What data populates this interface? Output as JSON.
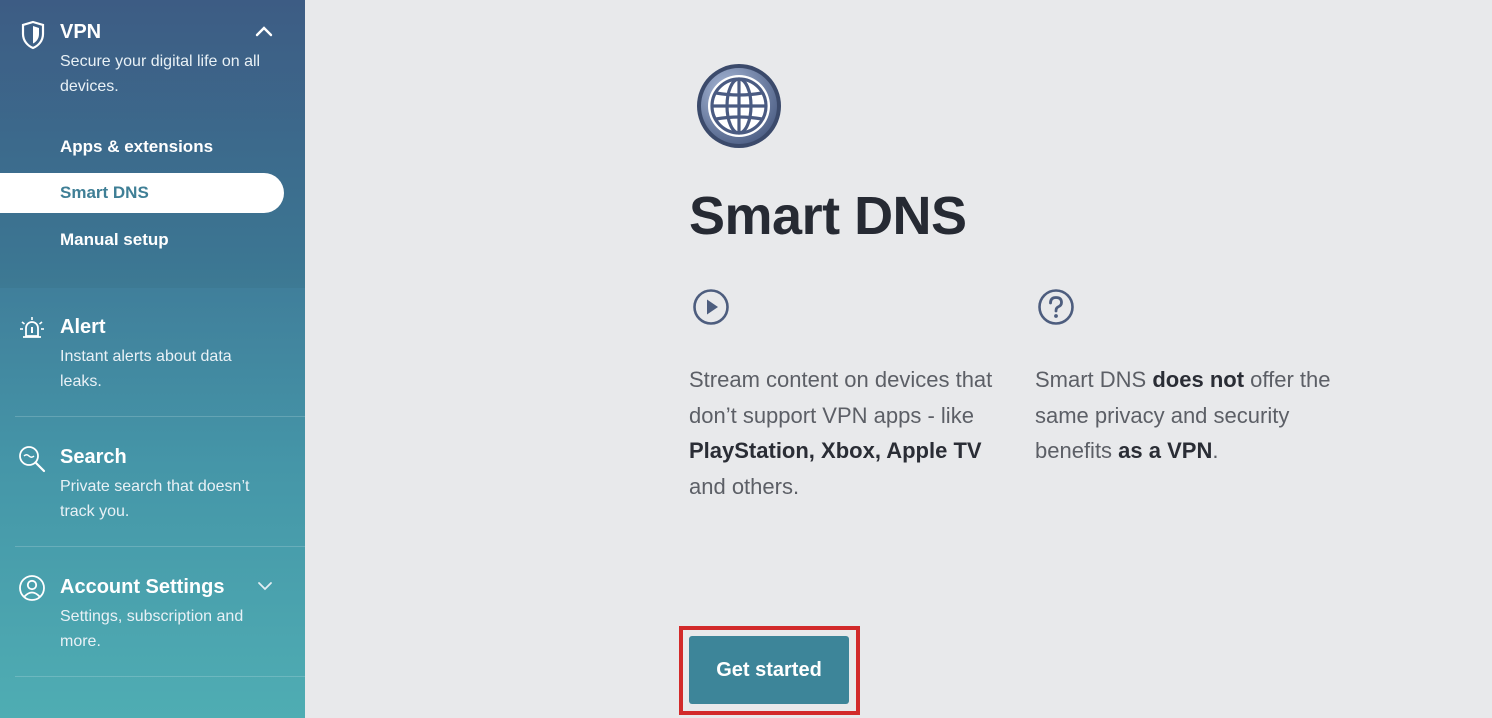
{
  "sidebar": {
    "vpn": {
      "title": "VPN",
      "description": "Secure your digital life on all devices.",
      "items": [
        {
          "label": "Apps & extensions",
          "active": false
        },
        {
          "label": "Smart DNS",
          "active": true
        },
        {
          "label": "Manual setup",
          "active": false
        }
      ]
    },
    "alert": {
      "title": "Alert",
      "description": "Instant alerts about data leaks."
    },
    "search": {
      "title": "Search",
      "description": "Private search that doesn’t track you."
    },
    "account": {
      "title": "Account Settings",
      "description": "Settings, subscription and more."
    }
  },
  "main": {
    "title": "Smart DNS",
    "left_col": {
      "pre": "Stream content on devices that don’t support VPN apps - like ",
      "bold": "PlayStation, Xbox, Apple TV",
      "post": " and others."
    },
    "right_col": {
      "pre": "Smart DNS ",
      "bold1": "does not",
      "mid": " offer the same privacy and security benefits ",
      "bold2": "as a VPN",
      "post": "."
    },
    "cta_label": "Get started"
  },
  "colors": {
    "accent": "#3d8599",
    "highlight": "#d22a2a",
    "sidebar_top": "#40608a",
    "sidebar_bottom": "#4fadb3"
  }
}
